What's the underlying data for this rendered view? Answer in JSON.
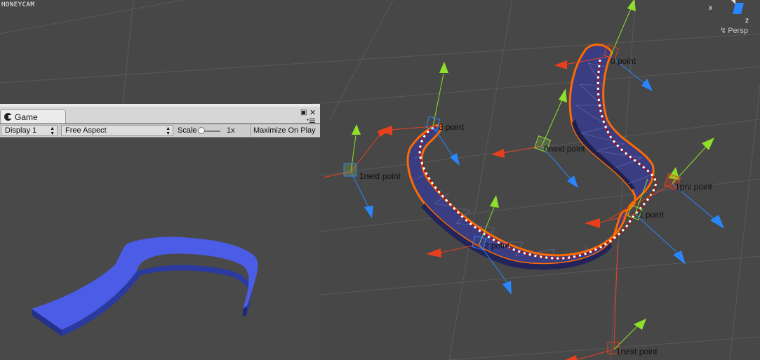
{
  "watermark": "HONEYCAM",
  "scene_view": {
    "projection_label": "Persp",
    "labels": [
      {
        "id": "0-point",
        "text": "0 point"
      },
      {
        "id": "3-point",
        "text": "3 point"
      },
      {
        "id": "0-next-point",
        "text": "0next point"
      },
      {
        "id": "1-next-point-left",
        "text": "1next point"
      },
      {
        "id": "1-prv-point",
        "text": "1prv point"
      },
      {
        "id": "1-point",
        "text": "1 point"
      },
      {
        "id": "2-point",
        "text": "2 point"
      },
      {
        "id": "1-next-point-bottom",
        "text": "1next point"
      }
    ],
    "axis_labels": {
      "x": "x",
      "z": "z"
    }
  },
  "game_window": {
    "tab_label": "Game",
    "display_value": "Display 1",
    "aspect_value": "Free Aspect",
    "scale_label": "Scale",
    "scale_value": "1x",
    "maximize_label": "Maximize On Play"
  },
  "colors": {
    "scene_background": "#474747",
    "grid_line": "#5b5b5b",
    "mesh_fill": "#3b3d82",
    "mesh_outline": "#ff6a00",
    "gizmo_x": "#e8401c",
    "gizmo_y": "#8ee02a",
    "gizmo_z": "#2a86ff",
    "game_mesh": "#4b5ce6"
  },
  "icons": [
    "tab-game-icon",
    "maximize-icon",
    "close-icon",
    "menu-icon",
    "persp-lock-icon",
    "scene-gizmo-icon"
  ]
}
